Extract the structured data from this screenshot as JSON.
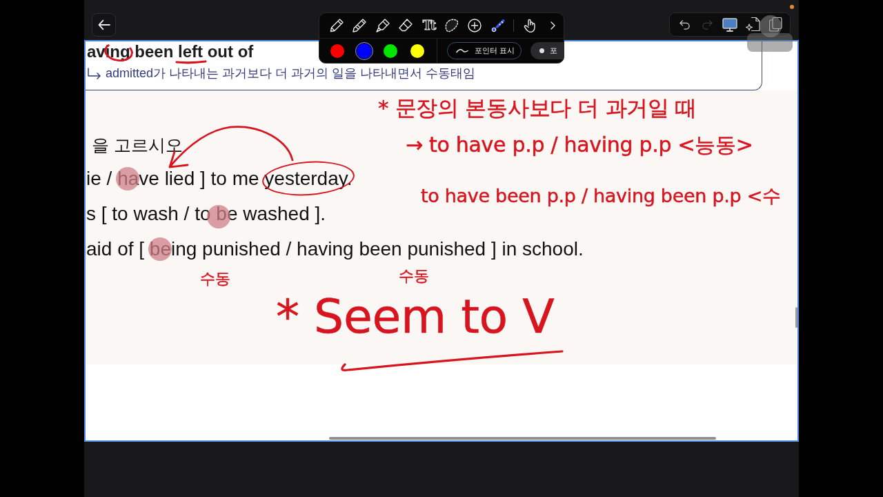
{
  "top_bar": {
    "actions": [
      {
        "kind": "undo",
        "disabled": false
      },
      {
        "kind": "redo",
        "disabled": true
      },
      {
        "kind": "presentation",
        "disabled": false
      },
      {
        "kind": "ai-document",
        "disabled": false
      },
      {
        "kind": "pages",
        "disabled": false
      }
    ]
  },
  "toolbar": {
    "tools": [
      {
        "kind": "pen",
        "selected": false
      },
      {
        "kind": "pencil",
        "selected": false
      },
      {
        "kind": "highlighter",
        "selected": false
      },
      {
        "kind": "eraser",
        "selected": false
      },
      {
        "kind": "text",
        "glyph": "Tt",
        "selected": false
      },
      {
        "kind": "lasso",
        "selected": false
      },
      {
        "kind": "add",
        "selected": false
      },
      {
        "kind": "laser",
        "selected": true
      },
      {
        "kind": "hand",
        "selected": false
      },
      {
        "kind": "more",
        "selected": false
      }
    ],
    "colors": [
      {
        "color": "#ff0000",
        "selected": false
      },
      {
        "color": "#0000ff",
        "selected": true
      },
      {
        "color": "#00e600",
        "selected": false
      },
      {
        "color": "#ffff00",
        "selected": false
      }
    ],
    "pointer_modes": [
      {
        "kind": "trail",
        "label": "포인터 표시"
      },
      {
        "kind": "dot",
        "label": "포"
      }
    ]
  },
  "page": {
    "note_box": {
      "heading": "aving been left out of",
      "note": "admitted가 나타내는 과거보다 더 과거의 일을 나타내면서 수동태임"
    },
    "instruction": "을 고르시오",
    "sentences": [
      "ie / have lied ] to me yesterday.",
      "s [ to wash / to be washed ].",
      "aid of [ being punished / having been punished ] in school."
    ],
    "handwriting": [
      "* 문장의 본동사보다 더 과거일 때",
      "→ to have p.p / having p.p <능동>",
      "to have been p.p / having been p.p <수",
      "수동",
      "수동",
      "* Seem to V"
    ]
  }
}
